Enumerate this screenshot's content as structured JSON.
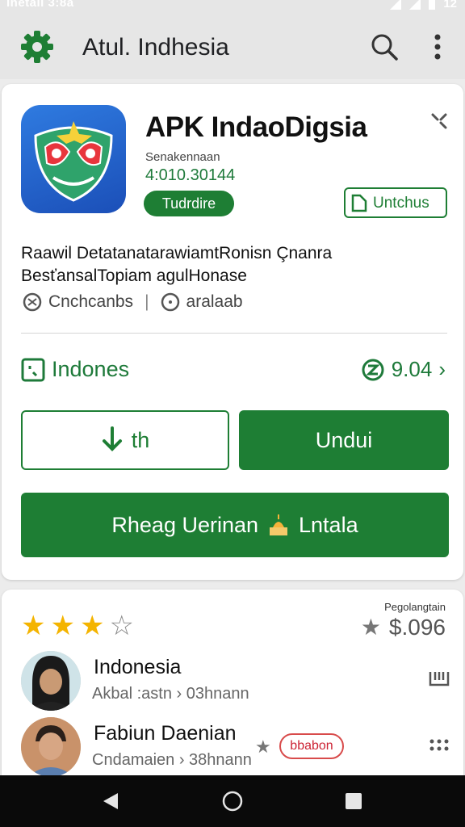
{
  "status_bar": {
    "left_text": "Inetall 3:8a",
    "right_text": "12"
  },
  "app_bar": {
    "title": "Atul. Indhesia"
  },
  "app": {
    "name": "APK IndaoDigsia",
    "developer": "Senakennaan",
    "version": "4:010.30144",
    "tag_label": "Tudrdire",
    "action_label": "Untchus",
    "description_line1": "Raawil DetatanatarawiamtRonisn Çnanra",
    "description_line2": "BesťansalTopiam agulHonase",
    "meta_left": "Cnchcanbs",
    "meta_right": "aralaab",
    "region_label": "Indones",
    "score_label": "9.04",
    "secondary_button": "th",
    "primary_button": "Undui",
    "wide_button": "Rheag Uerinan",
    "wide_button_suffix": "Lntala"
  },
  "reviews": {
    "stars_filled": 3,
    "stars_total": 4,
    "caption": "Pegolangtain",
    "score": "$.096",
    "items": [
      {
        "name": "Indonesia",
        "sub": "Akbal :astn  ›  03hnann"
      },
      {
        "name": "Fabiun Daenian",
        "sub": "Cndamaien  ›  38hnann",
        "badge": "bbabon"
      }
    ]
  },
  "colors": {
    "accent": "#1e7e34",
    "star": "#f4b400"
  }
}
